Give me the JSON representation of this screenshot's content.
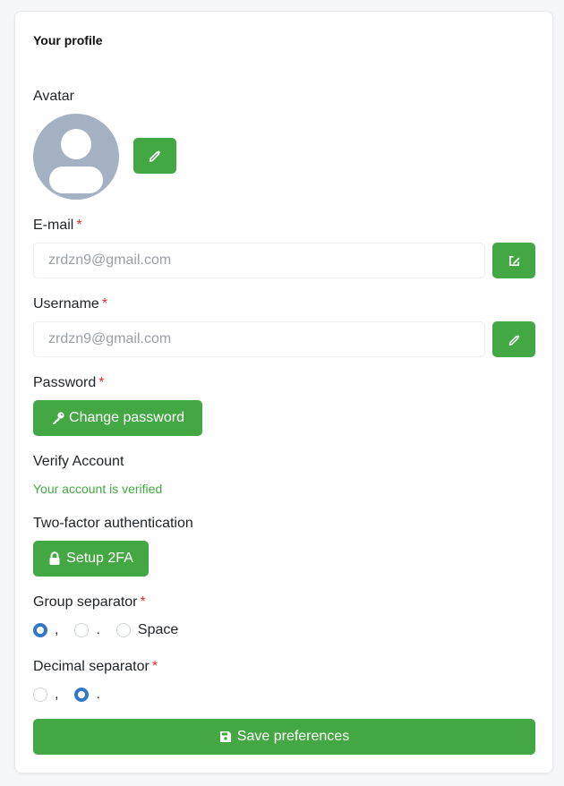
{
  "profile": {
    "title": "Your profile",
    "avatar_label": "Avatar",
    "email": {
      "label": "E-mail",
      "required_mark": "*",
      "value": "zrdzn9@gmail.com"
    },
    "username": {
      "label": "Username",
      "required_mark": "*",
      "value": "zrdzn9@gmail.com"
    },
    "password": {
      "label": "Password",
      "required_mark": "*",
      "button_label": "Change password"
    },
    "verify": {
      "label": "Verify Account",
      "status": "Your account is verified"
    },
    "twofa": {
      "label": "Two-factor authentication",
      "button_label": "Setup 2FA"
    },
    "group_separator": {
      "label": "Group separator",
      "required_mark": "*",
      "options": [
        {
          "label": ",",
          "checked": true
        },
        {
          "label": ".",
          "checked": false
        },
        {
          "label": "Space",
          "checked": false
        }
      ]
    },
    "decimal_separator": {
      "label": "Decimal separator",
      "required_mark": "*",
      "options": [
        {
          "label": ",",
          "checked": false
        },
        {
          "label": ".",
          "checked": true
        }
      ]
    },
    "save_label": "Save preferences"
  },
  "icons": {
    "avatar_edit": "pencil-icon",
    "email_edit": "pencil-square-icon",
    "username_edit": "pencil-icon",
    "password": "key-icon",
    "twofa": "lock-icon",
    "save": "floppy-disk-icon"
  },
  "colors": {
    "accent": "#43a843",
    "required": "#e03131",
    "radio_checked": "#3178c6",
    "avatar_bg": "#a3b1c3"
  }
}
